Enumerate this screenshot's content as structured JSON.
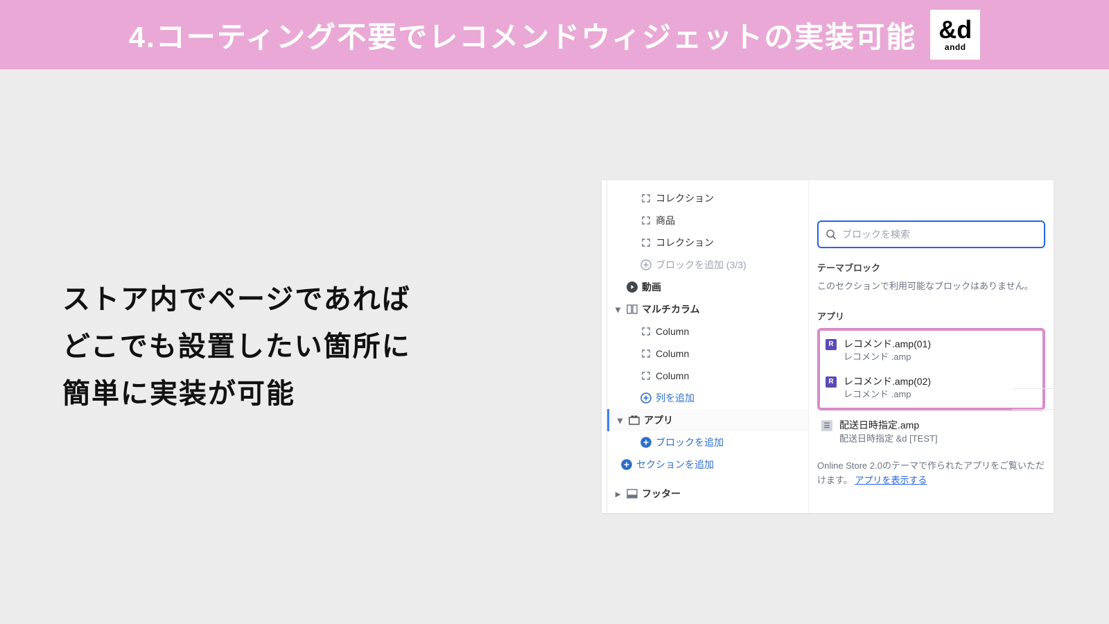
{
  "header": {
    "title": "4.コーティング不要でレコメンドウィジェットの実装可能",
    "logo_main": "&d",
    "logo_sub": "andd"
  },
  "left_copy": {
    "line1": "ストア内でページであれば",
    "line2": "どこでも設置したい箇所に",
    "line3": "簡単に実装が可能"
  },
  "tree": {
    "collection1": "コレクション",
    "product": "商品",
    "collection2": "コレクション",
    "add_block_count": "ブロックを追加 (3/3)",
    "video": "動画",
    "multicolumn": "マルチカラム",
    "column": "Column",
    "add_column": "列を追加",
    "app": "アプリ",
    "add_block": "ブロックを追加",
    "add_section": "セクションを追加",
    "footer": "フッター"
  },
  "right": {
    "search_placeholder": "ブロックを検索",
    "theme_blocks": "テーマブロック",
    "empty": "このセクションで利用可能なブロックはありません。",
    "apps": "アプリ",
    "app_items": [
      {
        "title": "レコメンド.amp(01)",
        "sub": "レコメンド .amp"
      },
      {
        "title": "レコメンド.amp(02)",
        "sub": "レコメンド .amp"
      }
    ],
    "delivery": {
      "title": "配送日時指定.amp",
      "sub": "配送日時指定 &d [TEST]"
    },
    "footer_msg_a": "Online Store 2.0のテーマで作られたアプリをご覧いただけます。",
    "footer_link": "アプリを表示する"
  }
}
